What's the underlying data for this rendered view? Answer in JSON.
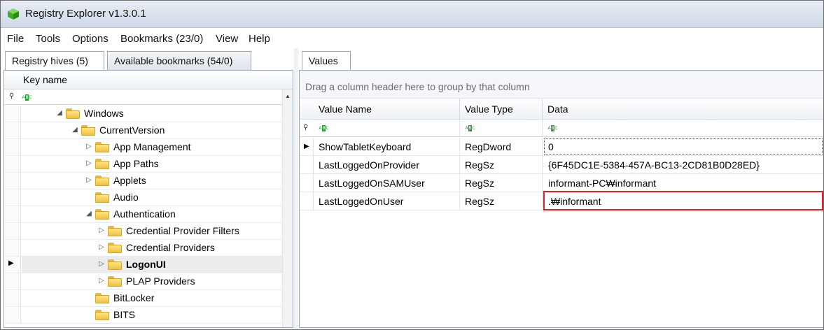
{
  "window": {
    "title": "Registry Explorer v1.3.0.1"
  },
  "menu": {
    "items": [
      "File",
      "Tools",
      "Options",
      "Bookmarks (23/0)",
      "View",
      "Help"
    ]
  },
  "left_tabs": [
    {
      "label": "Registry hives (5)",
      "active": true
    },
    {
      "label": "Available bookmarks (54/0)",
      "active": false
    }
  ],
  "tree": {
    "header": "Key name",
    "rows": [
      {
        "label": "Windows",
        "expander": "◢",
        "bold": false,
        "selected": false,
        "depth": 0
      },
      {
        "label": "CurrentVersion",
        "expander": "◢",
        "bold": false,
        "selected": false,
        "depth": 1
      },
      {
        "label": "App Management",
        "expander": "▷",
        "bold": false,
        "selected": false,
        "depth": 2
      },
      {
        "label": "App Paths",
        "expander": "▷",
        "bold": false,
        "selected": false,
        "depth": 2
      },
      {
        "label": "Applets",
        "expander": "▷",
        "bold": false,
        "selected": false,
        "depth": 2
      },
      {
        "label": "Audio",
        "expander": "",
        "bold": false,
        "selected": false,
        "depth": 2
      },
      {
        "label": "Authentication",
        "expander": "◢",
        "bold": false,
        "selected": false,
        "depth": 2
      },
      {
        "label": "Credential Provider Filters",
        "expander": "▷",
        "bold": false,
        "selected": false,
        "depth": 3
      },
      {
        "label": "Credential Providers",
        "expander": "▷",
        "bold": false,
        "selected": false,
        "depth": 3
      },
      {
        "label": "LogonUI",
        "expander": "▷",
        "bold": true,
        "selected": true,
        "depth": 3
      },
      {
        "label": "PLAP Providers",
        "expander": "▷",
        "bold": false,
        "selected": false,
        "depth": 3
      },
      {
        "label": "BitLocker",
        "expander": "",
        "bold": false,
        "selected": false,
        "depth": 2
      },
      {
        "label": "BITS",
        "expander": "",
        "bold": false,
        "selected": false,
        "depth": 2
      }
    ]
  },
  "right_tab": {
    "label": "Values"
  },
  "values": {
    "group_hint": "Drag a column header here to group by that column",
    "columns": [
      "Value Name",
      "Value Type",
      "Data"
    ],
    "rows": [
      {
        "name": "ShowTabletKeyboard",
        "type": "RegDword",
        "data": "0",
        "current": true,
        "highlighted": false
      },
      {
        "name": "LastLoggedOnProvider",
        "type": "RegSz",
        "data": "{6F45DC1E-5384-457A-BC13-2CD81B0D28ED}",
        "current": false,
        "highlighted": false
      },
      {
        "name": "LastLoggedOnSAMUser",
        "type": "RegSz",
        "data": "informant-PC₩informant",
        "current": false,
        "highlighted": false
      },
      {
        "name": "LastLoggedOnUser",
        "type": "RegSz",
        "data": ".₩informant",
        "current": false,
        "highlighted": true
      }
    ]
  },
  "icons": {
    "app": "registry-cube-icon",
    "folder": "folder-icon",
    "filter": "abc-filter-icon",
    "pin": "pin-icon"
  },
  "colors": {
    "highlight_border": "#e02020",
    "folder_fill": "#f2c13c",
    "filter_icon": "#2aa03a"
  }
}
